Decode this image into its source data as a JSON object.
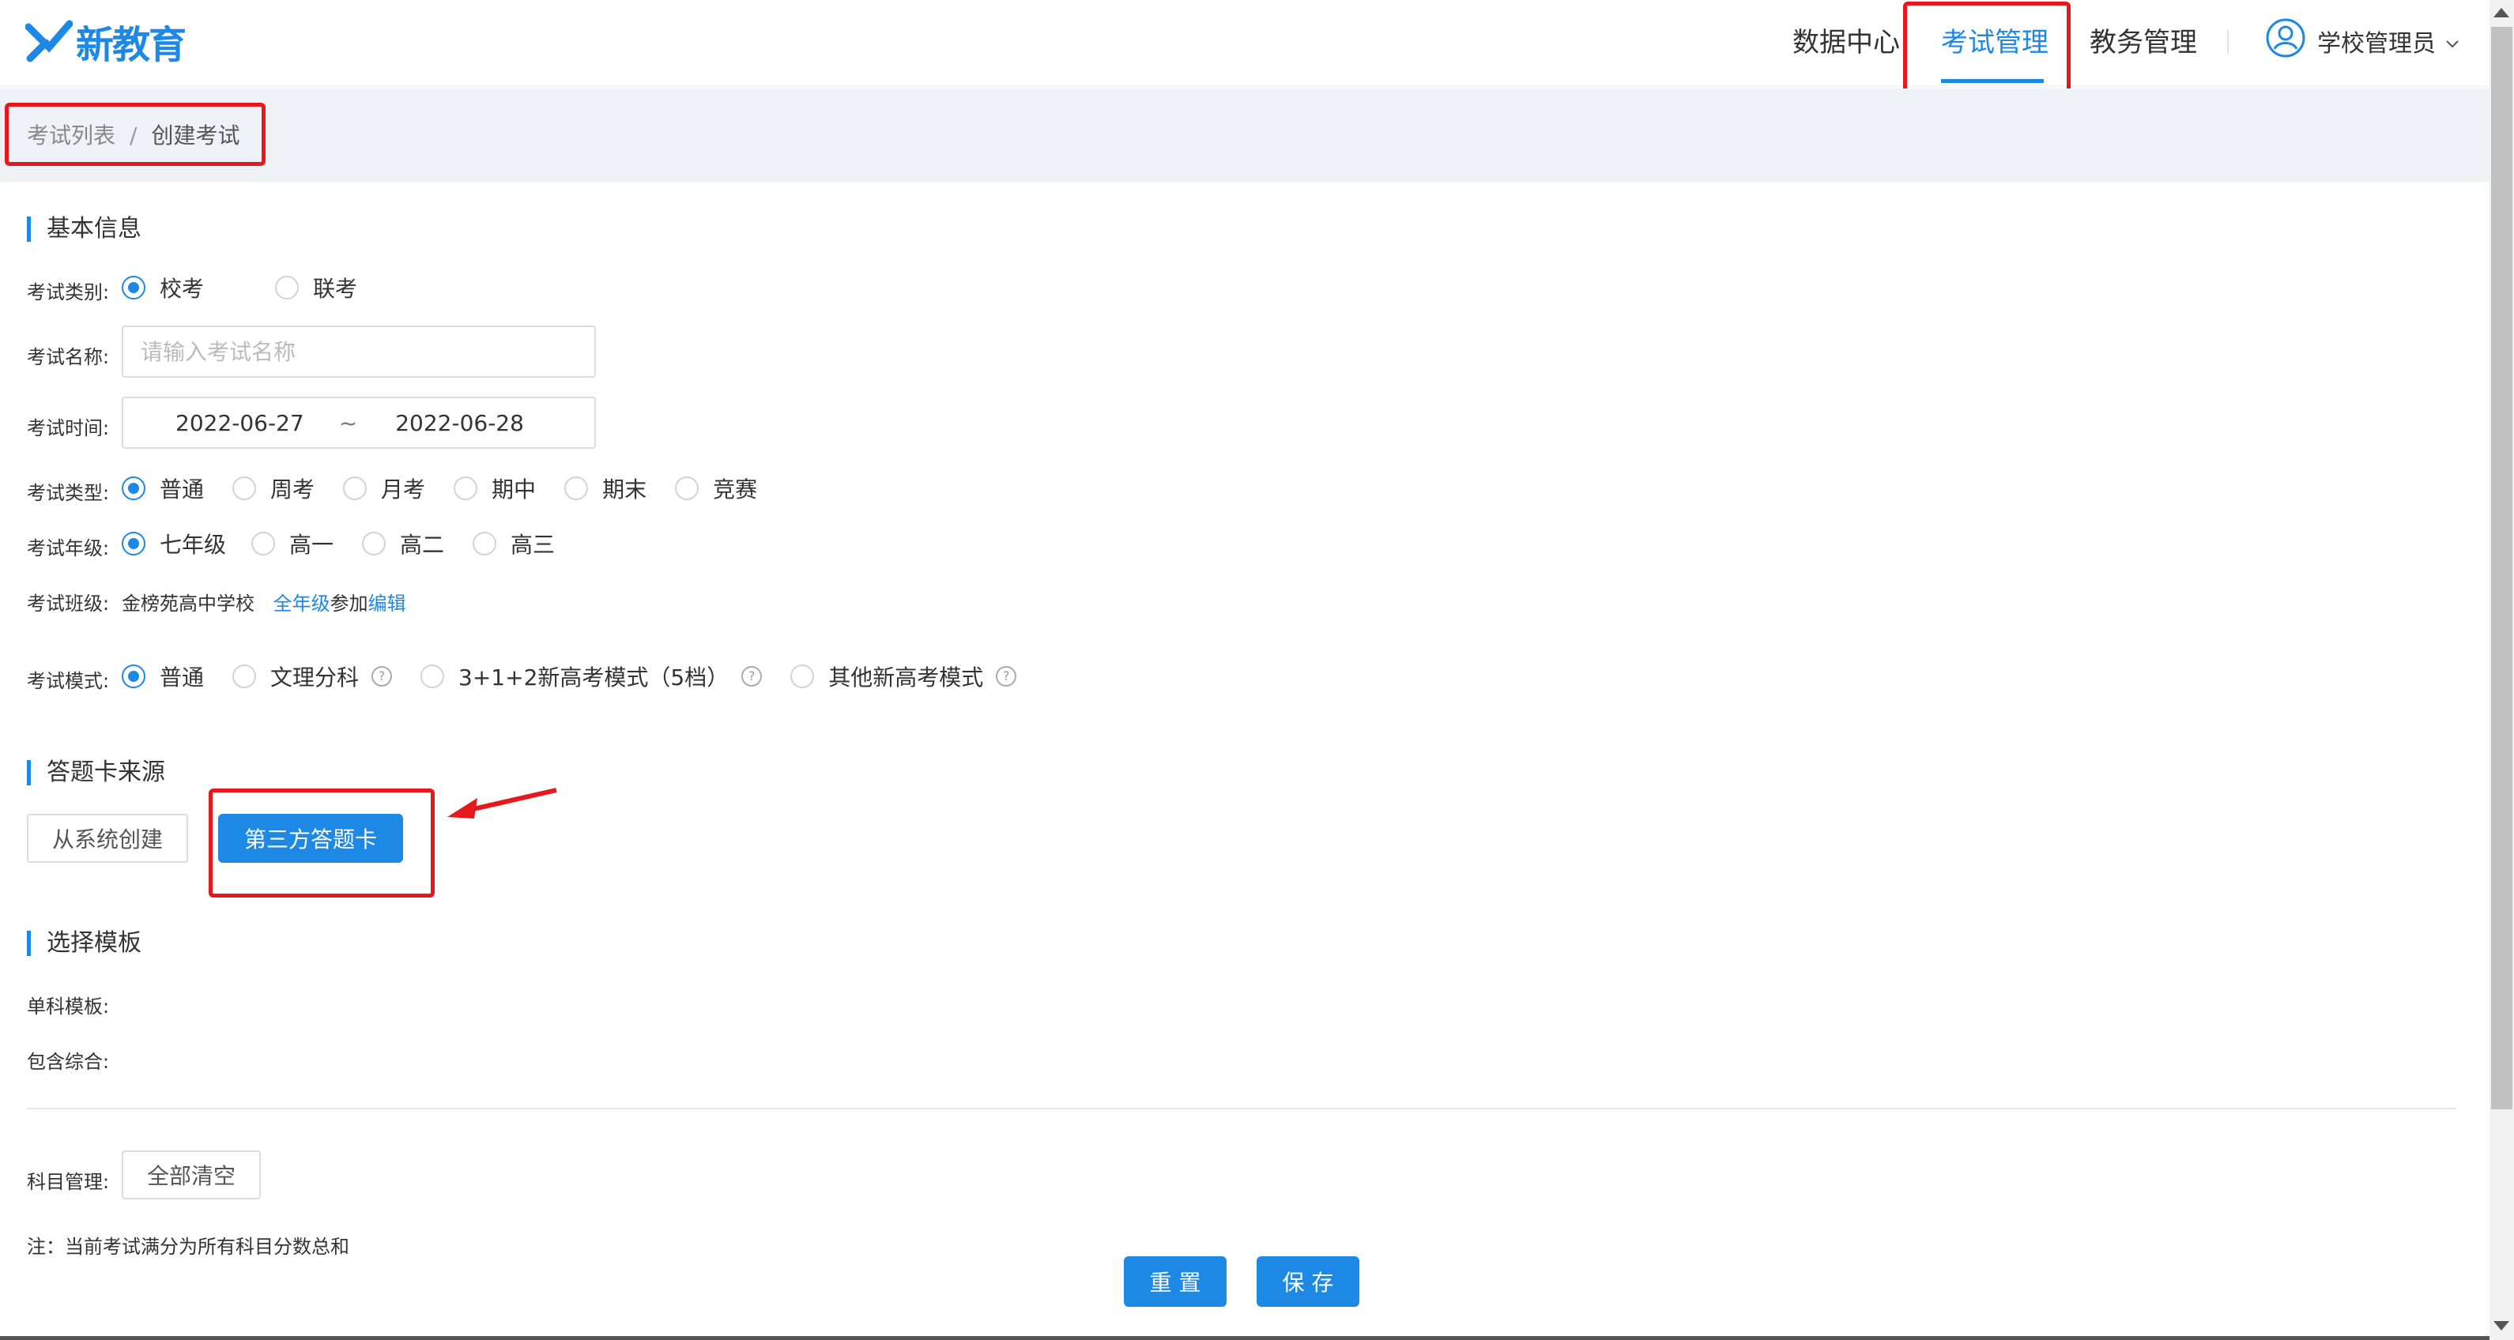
{
  "header": {
    "logo_text": "新教育",
    "nav": [
      "数据中心",
      "考试管理",
      "教务管理"
    ],
    "active_nav": "考试管理",
    "user_name": "学校管理员"
  },
  "breadcrumb": {
    "parent": "考试列表",
    "separator": "/",
    "current": "创建考试"
  },
  "basic": {
    "title": "基本信息",
    "category_label": "考试类别:",
    "category_options": [
      "校考",
      "联考"
    ],
    "name_label": "考试名称:",
    "name_placeholder": "请输入考试名称",
    "name_value": "",
    "time_label": "考试时间:",
    "time_start": "2022-06-27",
    "time_sep": "~",
    "time_end": "2022-06-28",
    "type_label": "考试类型:",
    "type_options": [
      "普通",
      "周考",
      "月考",
      "期中",
      "期末",
      "竞赛"
    ],
    "grade_label": "考试年级:",
    "grade_options": [
      "七年级",
      "高一",
      "高二",
      "高三"
    ],
    "class_label": "考试班级:",
    "class_school": "金榜苑高中学校",
    "class_scope": "全年级",
    "class_join": "参加",
    "class_edit": "编辑",
    "mode_label": "考试模式:",
    "mode_options": [
      "普通",
      "文理分科",
      "3+1+2新高考模式（5档）",
      "其他新高考模式"
    ],
    "help_glyph": "?"
  },
  "card_source": {
    "title": "答题卡来源",
    "btn_system": "从系统创建",
    "btn_third": "第三方答题卡"
  },
  "template": {
    "title": "选择模板",
    "single_label": "单科模板:",
    "combo_label": "包含综合:"
  },
  "subjects": {
    "label": "科目管理:",
    "clear_btn": "全部清空",
    "note": "注：当前考试满分为所有科目分数总和"
  },
  "actions": {
    "reset": "重 置",
    "save": "保 存"
  },
  "colors": {
    "accent": "#1e88e5",
    "highlight": "#e5191c"
  }
}
